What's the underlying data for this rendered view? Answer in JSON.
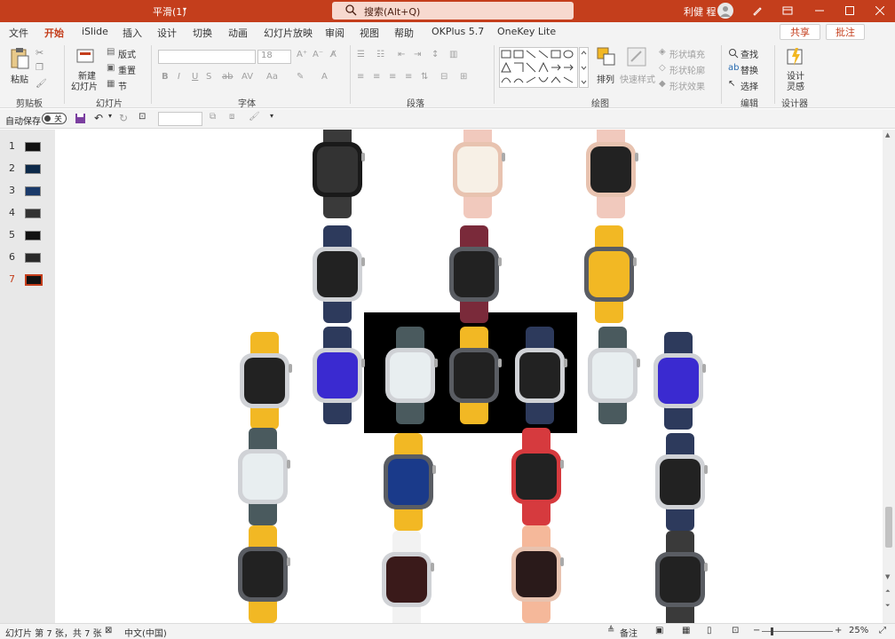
{
  "titlebar": {
    "doc_title": "平滑(1)",
    "search_placeholder": "搜索(Alt+Q)",
    "user_name": "利健 程"
  },
  "tabs": [
    {
      "label": "文件"
    },
    {
      "label": "开始"
    },
    {
      "label": "iSlide"
    },
    {
      "label": "插入"
    },
    {
      "label": "设计"
    },
    {
      "label": "切换"
    },
    {
      "label": "动画"
    },
    {
      "label": "幻灯片放映"
    },
    {
      "label": "审阅"
    },
    {
      "label": "视图"
    },
    {
      "label": "帮助"
    },
    {
      "label": "OKPlus 5.7"
    },
    {
      "label": "OneKey Lite"
    }
  ],
  "share_label": "共享",
  "comment_label": "批注",
  "ribbon": {
    "clipboard": {
      "paste": "粘贴",
      "group": "剪贴板"
    },
    "slides": {
      "new_slide": "新建",
      "new_slide2": "幻灯片",
      "layout": "版式",
      "reset": "重置",
      "section": "节",
      "group": "幻灯片"
    },
    "font": {
      "size": "18",
      "group": "字体"
    },
    "paragraph": {
      "group": "段落"
    },
    "drawing": {
      "arrange": "排列",
      "quick_styles": "快速样式",
      "fill": "形状填充",
      "outline": "形状轮廓",
      "effects": "形状效果",
      "group": "绘图"
    },
    "editing": {
      "find": "查找",
      "replace": "替换",
      "select": "选择",
      "group": "编辑"
    },
    "designer": {
      "design_ideas": "设计",
      "design_ideas2": "灵感",
      "group": "设计器"
    }
  },
  "qat": {
    "autosave": "自动保存",
    "toggle": "关"
  },
  "thumbnails": [
    {
      "num": "1"
    },
    {
      "num": "2"
    },
    {
      "num": "3"
    },
    {
      "num": "4"
    },
    {
      "num": "5"
    },
    {
      "num": "6"
    },
    {
      "num": "7"
    }
  ],
  "statusbar": {
    "slide_info": "幻灯片 第 7 张，共 7 张",
    "language": "中文(中国)",
    "notes": "备注",
    "zoom": "25%"
  },
  "colors": {
    "accent": "#c43e1c",
    "yellow_band": "#f2b824",
    "navy_band": "#2d3a5c"
  }
}
